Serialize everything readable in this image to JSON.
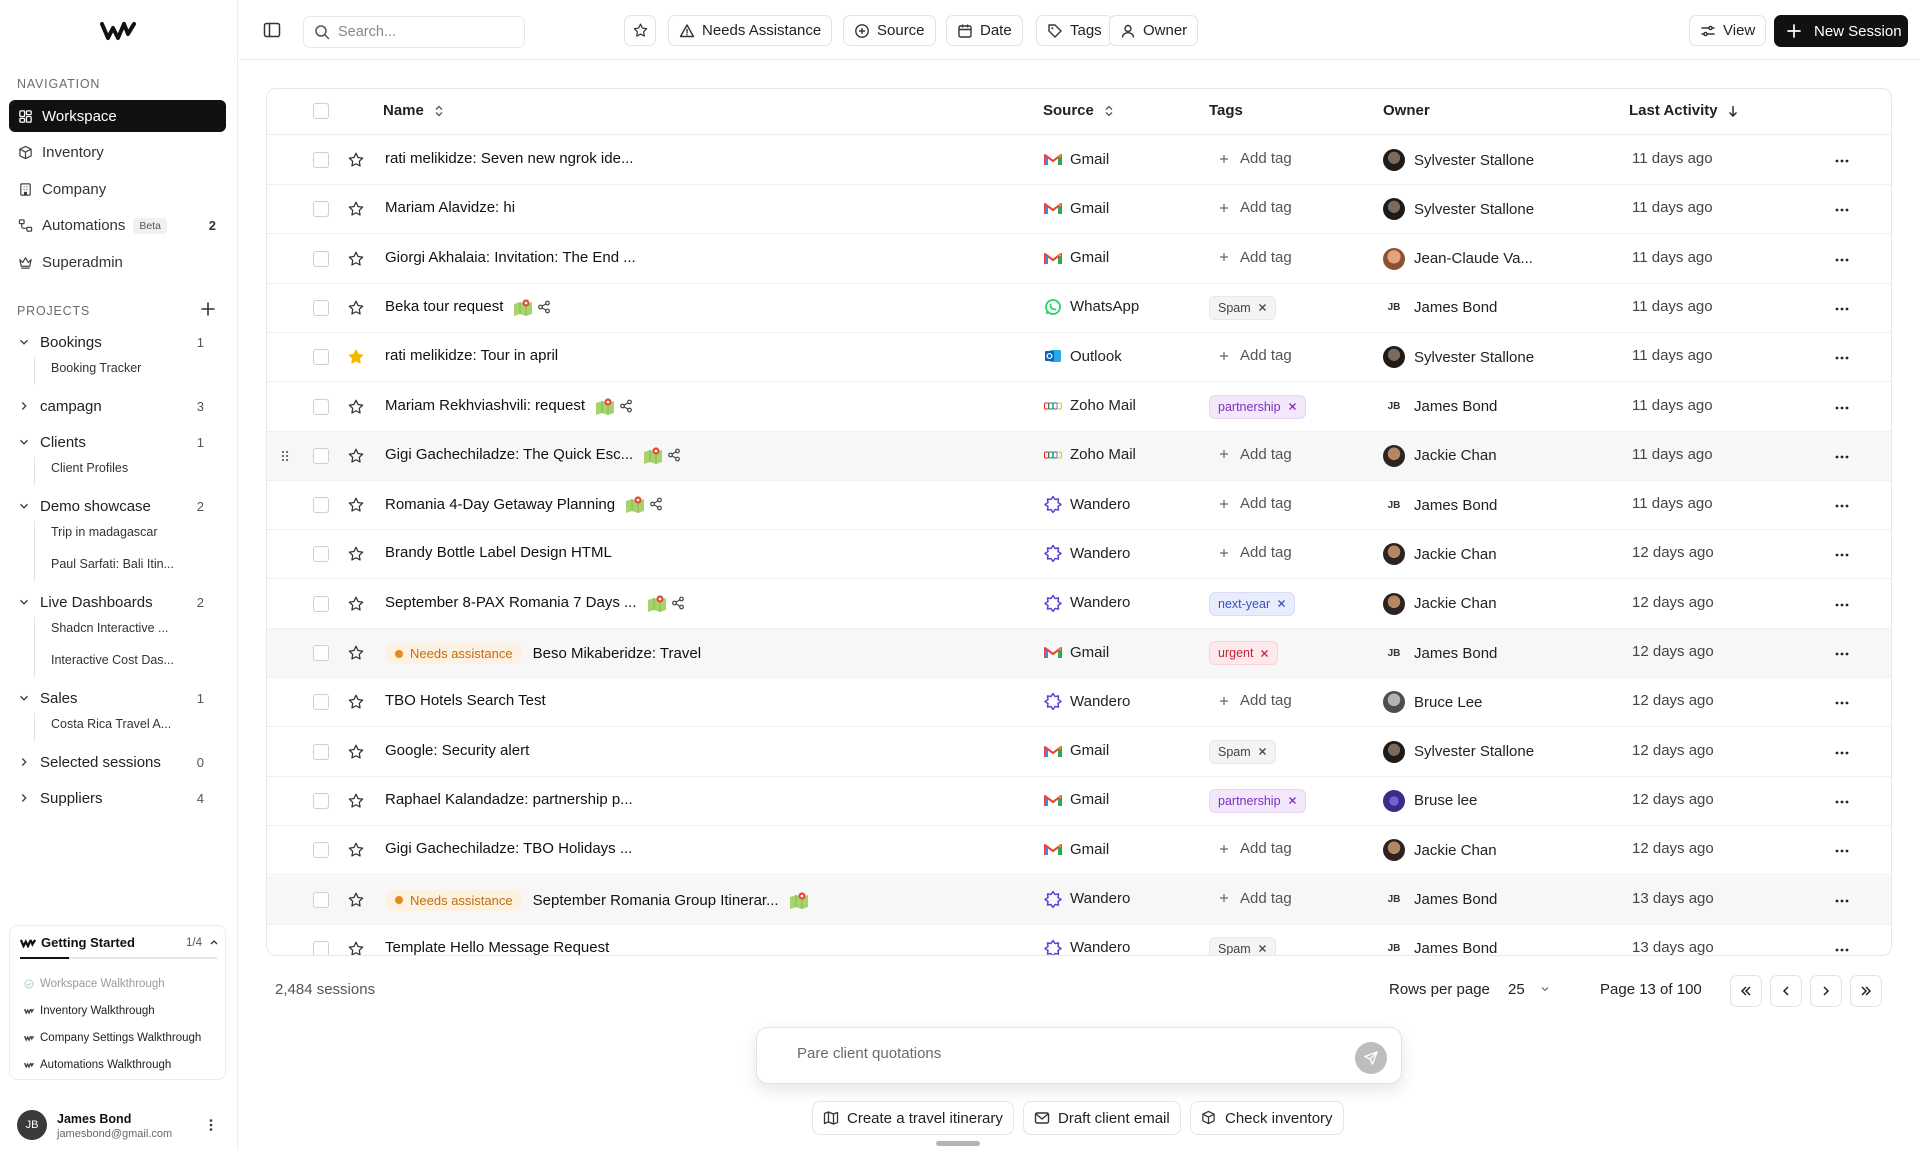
{
  "sidebar": {
    "nav_label": "NAVIGATION",
    "nav": [
      {
        "label": "Workspace",
        "icon": "dashboard-icon",
        "active": true
      },
      {
        "label": "Inventory",
        "icon": "box-icon"
      },
      {
        "label": "Company",
        "icon": "building-icon"
      },
      {
        "label": "Automations",
        "icon": "workflow-icon",
        "badge": "Beta",
        "count": "2"
      },
      {
        "label": "Superadmin",
        "icon": "crown-icon"
      }
    ],
    "projects_label": "PROJECTS",
    "projects": [
      {
        "label": "Bookings",
        "count": "1",
        "expanded": true,
        "children": [
          "Booking Tracker"
        ]
      },
      {
        "label": "campagn",
        "count": "3",
        "expanded": false,
        "children": []
      },
      {
        "label": "Clients",
        "count": "1",
        "expanded": true,
        "children": [
          "Client Profiles"
        ]
      },
      {
        "label": "Demo showcase",
        "count": "2",
        "expanded": true,
        "children": [
          "Trip in madagascar",
          "Paul Sarfati: Bali Itin..."
        ]
      },
      {
        "label": "Live Dashboards",
        "count": "2",
        "expanded": true,
        "children": [
          "Shadcn Interactive ...",
          "Interactive Cost Das..."
        ]
      },
      {
        "label": "Sales",
        "count": "1",
        "expanded": true,
        "children": [
          "Costa Rica Travel A..."
        ]
      },
      {
        "label": "Selected sessions",
        "count": "0",
        "expanded": false,
        "children": []
      },
      {
        "label": "Suppliers",
        "count": "4",
        "expanded": false,
        "children": []
      }
    ],
    "getting_started": {
      "title": "Getting Started",
      "progress": "1/4",
      "progress_fraction": 0.25,
      "items": [
        {
          "label": "Workspace Walkthrough",
          "done": true
        },
        {
          "label": "Inventory Walkthrough",
          "done": false
        },
        {
          "label": "Company Settings Walkthrough",
          "done": false
        },
        {
          "label": "Automations Walkthrough",
          "done": false
        }
      ]
    },
    "user": {
      "initials": "JB",
      "name": "James Bond",
      "email": "jamesbond@gmail.com"
    }
  },
  "topbar": {
    "search_placeholder": "Search...",
    "filters": [
      {
        "label": "Needs Assistance",
        "icon": "alert-triangle-icon"
      },
      {
        "label": "Source",
        "icon": "plus-circle-icon"
      },
      {
        "label": "Date",
        "icon": "calendar-icon"
      },
      {
        "label": "Tags",
        "icon": "tag-icon"
      },
      {
        "label": "Owner",
        "icon": "user-icon"
      }
    ],
    "view_label": "View",
    "new_session_label": "New Session"
  },
  "table": {
    "columns": {
      "name": "Name",
      "source": "Source",
      "tags": "Tags",
      "owner": "Owner",
      "last_activity": "Last Activity"
    },
    "add_tag_label": "Add tag",
    "needs_label": "Needs assistance",
    "rows": [
      {
        "name": "rati melikidze: Seven new ngrok ide...",
        "source": "Gmail",
        "tag": "",
        "owner": "Sylvester Stallone",
        "owner_av": "photo-dark",
        "activity": "11 days ago"
      },
      {
        "name": "Mariam Alavidze: hi",
        "source": "Gmail",
        "tag": "",
        "owner": "Sylvester Stallone",
        "owner_av": "photo-dark",
        "activity": "11 days ago"
      },
      {
        "name": "Giorgi Akhalaia: Invitation: The End ...",
        "source": "Gmail",
        "tag": "",
        "owner": "Jean-Claude Va...",
        "owner_av": "photo-warm",
        "activity": "11 days ago"
      },
      {
        "name": "Beka tour request",
        "source": "WhatsApp",
        "tag": "Spam",
        "owner": "James Bond",
        "owner_av": "initials",
        "activity": "11 days ago",
        "map": true,
        "share": true
      },
      {
        "name": "rati melikidze: Tour in april",
        "source": "Outlook",
        "tag": "",
        "owner": "Sylvester Stallone",
        "owner_av": "photo-dark",
        "activity": "11 days ago",
        "starred": true
      },
      {
        "name": "Mariam Rekhviashvili: request",
        "source": "Zoho Mail",
        "tag": "partnership",
        "owner": "James Bond",
        "owner_av": "initials",
        "activity": "11 days ago",
        "map": true,
        "share": true
      },
      {
        "name": "Gigi Gachechiladze: The Quick Esc...",
        "source": "Zoho Mail",
        "tag": "",
        "owner": "Jackie Chan",
        "owner_av": "photo-mid",
        "activity": "11 days ago",
        "map": true,
        "share": true,
        "hover": true
      },
      {
        "name": "Romania 4-Day Getaway Planning",
        "source": "Wandero",
        "tag": "",
        "owner": "James Bond",
        "owner_av": "initials",
        "activity": "11 days ago",
        "map": true,
        "share": true
      },
      {
        "name": "Brandy Bottle Label Design HTML",
        "source": "Wandero",
        "tag": "",
        "owner": "Jackie Chan",
        "owner_av": "photo-mid",
        "activity": "12 days ago"
      },
      {
        "name": "September 8-PAX Romania 7 Days ...",
        "source": "Wandero",
        "tag": "next-year",
        "owner": "Jackie Chan",
        "owner_av": "photo-mid",
        "activity": "12 days ago",
        "map": true,
        "share": true
      },
      {
        "name": "Beso Mikaberidze: Travel",
        "source": "Gmail",
        "tag": "urgent",
        "owner": "James Bond",
        "owner_av": "initials",
        "activity": "12 days ago",
        "needs": true,
        "hover": true
      },
      {
        "name": "TBO Hotels Search Test",
        "source": "Wandero",
        "tag": "",
        "owner": "Bruce Lee",
        "owner_av": "photo-gray",
        "activity": "12 days ago"
      },
      {
        "name": "Google: Security alert",
        "source": "Gmail",
        "tag": "Spam",
        "owner": "Sylvester Stallone",
        "owner_av": "photo-dark",
        "activity": "12 days ago"
      },
      {
        "name": "Raphael Kalandadze: partnership p...",
        "source": "Gmail",
        "tag": "partnership",
        "owner": "Bruse lee",
        "owner_av": "photo-purple",
        "activity": "12 days ago"
      },
      {
        "name": "Gigi Gachechiladze: TBO Holidays ...",
        "source": "Gmail",
        "tag": "",
        "owner": "Jackie Chan",
        "owner_av": "photo-mid",
        "activity": "12 days ago"
      },
      {
        "name": "September Romania Group Itinerar...",
        "source": "Wandero",
        "tag": "",
        "owner": "James Bond",
        "owner_av": "initials",
        "activity": "13 days ago",
        "needs": true,
        "map": true,
        "hover": true
      },
      {
        "name": "Template Hello Message Request",
        "source": "Wandero",
        "tag": "Spam",
        "owner": "James Bond",
        "owner_av": "initials",
        "activity": "13 days ago"
      }
    ]
  },
  "footer": {
    "sessions": "2,484 sessions",
    "rows_per_page_label": "Rows per page",
    "rows_per_page": "25",
    "page_info": "Page 13 of 100"
  },
  "chat": {
    "placeholder": "Pare client quotations",
    "actions": [
      {
        "label": "Create a travel itinerary",
        "icon": "map-icon"
      },
      {
        "label": "Draft client email",
        "icon": "mail-icon"
      },
      {
        "label": "Check inventory",
        "icon": "box-icon"
      }
    ]
  },
  "colors": {
    "accent": "#111111",
    "needs_bg": "#fdf1e2",
    "needs_text": "#c26d10",
    "tag_partnership": "#7b2fbf",
    "tag_urgent": "#c0283a",
    "tag_nextyear": "#3b4fc4"
  }
}
